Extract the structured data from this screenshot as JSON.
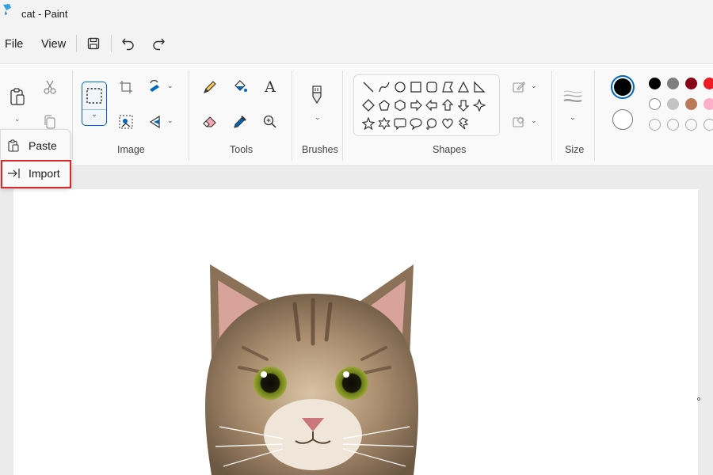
{
  "window": {
    "title": "cat - Paint"
  },
  "menu": {
    "file": "File",
    "view": "View"
  },
  "ribbon": {
    "groups": {
      "image": "Image",
      "tools": "Tools",
      "brushes": "Brushes",
      "shapes": "Shapes",
      "size": "Size"
    }
  },
  "dropdown": {
    "items": [
      {
        "label": "Paste",
        "icon": "clipboard-icon"
      },
      {
        "label": "Import",
        "icon": "import-arrow-icon"
      }
    ]
  },
  "colors": {
    "primary": "#000000",
    "secondary": "#ffffff",
    "palette": [
      "#000000",
      "#7f7f7f",
      "#880015",
      "#ed1c24",
      "#ffffff",
      "#c3c3c3",
      "#b97a57",
      "#ffaec9"
    ],
    "accent": "#0067c0",
    "highlight": "#d9272e"
  },
  "canvas": {
    "image": "cat-photo"
  }
}
